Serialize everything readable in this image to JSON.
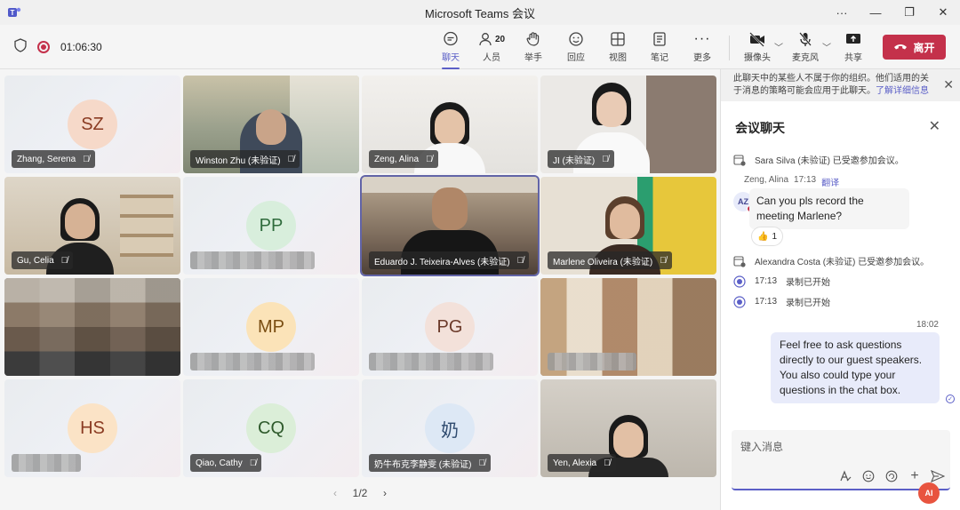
{
  "window": {
    "title": "Microsoft Teams 会议"
  },
  "toolbar": {
    "timer": "01:06:30",
    "chat_label": "聊天",
    "people_label": "人员",
    "people_count": "20",
    "raise_label": "举手",
    "react_label": "回应",
    "view_label": "视图",
    "notes_label": "笔记",
    "more_label": "更多",
    "camera_label": "摄像头",
    "mic_label": "麦克风",
    "share_label": "共享",
    "leave_label": "离开"
  },
  "tiles": [
    {
      "name": "Zhang, Serena",
      "initials": "SZ",
      "color": "#f6d9c9"
    },
    {
      "name": "Winston Zhu (未验证)"
    },
    {
      "name": "Zeng, Alina"
    },
    {
      "name": "JI (未验证)"
    },
    {
      "name": "Gu, Celia"
    },
    {
      "name": "",
      "initials": "PP",
      "color": "#d8eedc"
    },
    {
      "name": "Eduardo J. Teixeira-Alves (未验证)"
    },
    {
      "name": "Marlene Oliveira (未验证)"
    },
    {
      "name": ""
    },
    {
      "name": "",
      "initials": "MP",
      "color": "#fbe3b8"
    },
    {
      "name": "",
      "initials": "PG",
      "color": "#f3e1da"
    },
    {
      "name": ""
    },
    {
      "name": "",
      "initials": "HS",
      "color": "#fbe3c6"
    },
    {
      "name": "Qiao, Cathy",
      "initials": "CQ",
      "color": "#dbeed8"
    },
    {
      "name": "奶牛布克李静雯 (未验证)",
      "initials": "奶",
      "color": "#dde8f5"
    },
    {
      "name": "Yen, Alexia"
    }
  ],
  "pager": {
    "text": "1/2"
  },
  "chat": {
    "notice": "此聊天中的某些人不属于你的组织。他们适用的关于消息的策略可能会应用于此聊天。",
    "notice_link": "了解详细信息",
    "title": "会议聊天",
    "sys1": "Sara Silva (未验证) 已受邀参加会议。",
    "msg1_author": "Zeng, Alina",
    "msg1_time": "17:13",
    "msg1_translate": "翻译",
    "msg1_avatar": "AZ",
    "msg1_text": "Can you pls record the meeting Marlene?",
    "msg1_reaction": "👍",
    "msg1_reaction_count": "1",
    "sys2": "Alexandra Costa (未验证) 已受邀参加会议。",
    "rec1_time": "17:13",
    "rec1_text": "录制已开始",
    "rec2_time": "17:13",
    "rec2_text": "录制已开始",
    "out_time": "18:02",
    "out_text": "Feel free to ask questions directly to our guest speakers. You also could type your questions in the chat box.",
    "composer_placeholder": "键入消息",
    "ai_badge": "AI"
  }
}
